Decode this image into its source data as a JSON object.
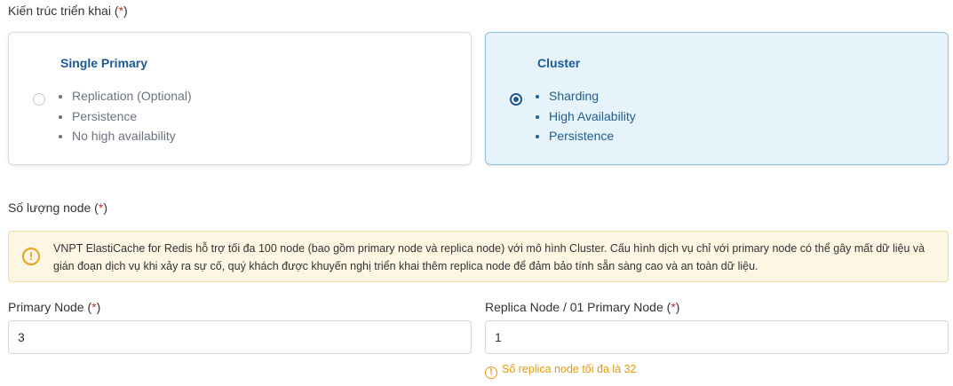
{
  "architecture": {
    "label": "Kiến trúc triển khai",
    "required_mark": "*",
    "options": [
      {
        "title": "Single Primary",
        "selected": false,
        "features": [
          "Replication (Optional)",
          "Persistence",
          "No high availability"
        ]
      },
      {
        "title": "Cluster",
        "selected": true,
        "features": [
          "Sharding",
          "High Availability",
          "Persistence"
        ]
      }
    ]
  },
  "node_count": {
    "label": "Số lượng node",
    "required_mark": "*"
  },
  "alert": {
    "icon": "warning-circle-icon",
    "text": "VNPT ElastiCache for Redis hỗ trợ tối đa 100 node (bao gồm primary node và replica node) với mô hình Cluster. Cấu hình dịch vụ chỉ với primary node có thể gây mất dữ liệu và gián đoạn dịch vụ khi xảy ra sự cố, quý khách được khuyến nghị triển khai thêm replica node để đảm bảo tính sẵn sàng cao và an toàn dữ liệu."
  },
  "primary_node": {
    "label": "Primary Node",
    "required_mark": "*",
    "value": "3"
  },
  "replica_node": {
    "label": "Replica Node / 01 Primary Node",
    "required_mark": "*",
    "value": "1",
    "hint": "Số replica node tối đa là 32"
  },
  "colors": {
    "accent": "#1a5a96",
    "selected_bg": "#e6f3fb",
    "warning": "#e8a317",
    "required": "#c0392b"
  }
}
